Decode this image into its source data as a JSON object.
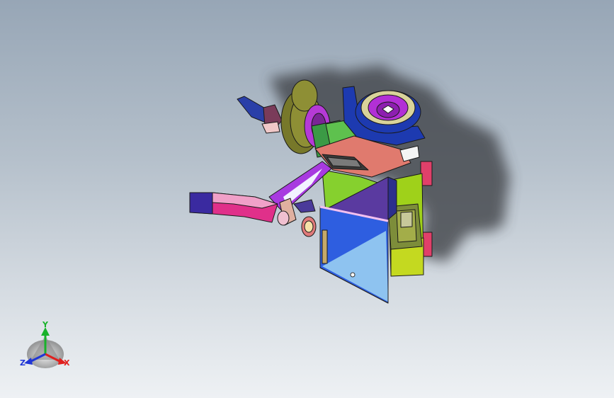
{
  "viewport": {
    "background_top": "#97a6b6",
    "background_bottom": "#eef1f4"
  },
  "model": {
    "shadow_color": "#3c3f44"
  },
  "triad": {
    "x_label": "X",
    "y_label": "Y",
    "z_label": "Z",
    "x_color": "#e0201e",
    "y_color": "#18b22a",
    "z_color": "#2036d6"
  }
}
